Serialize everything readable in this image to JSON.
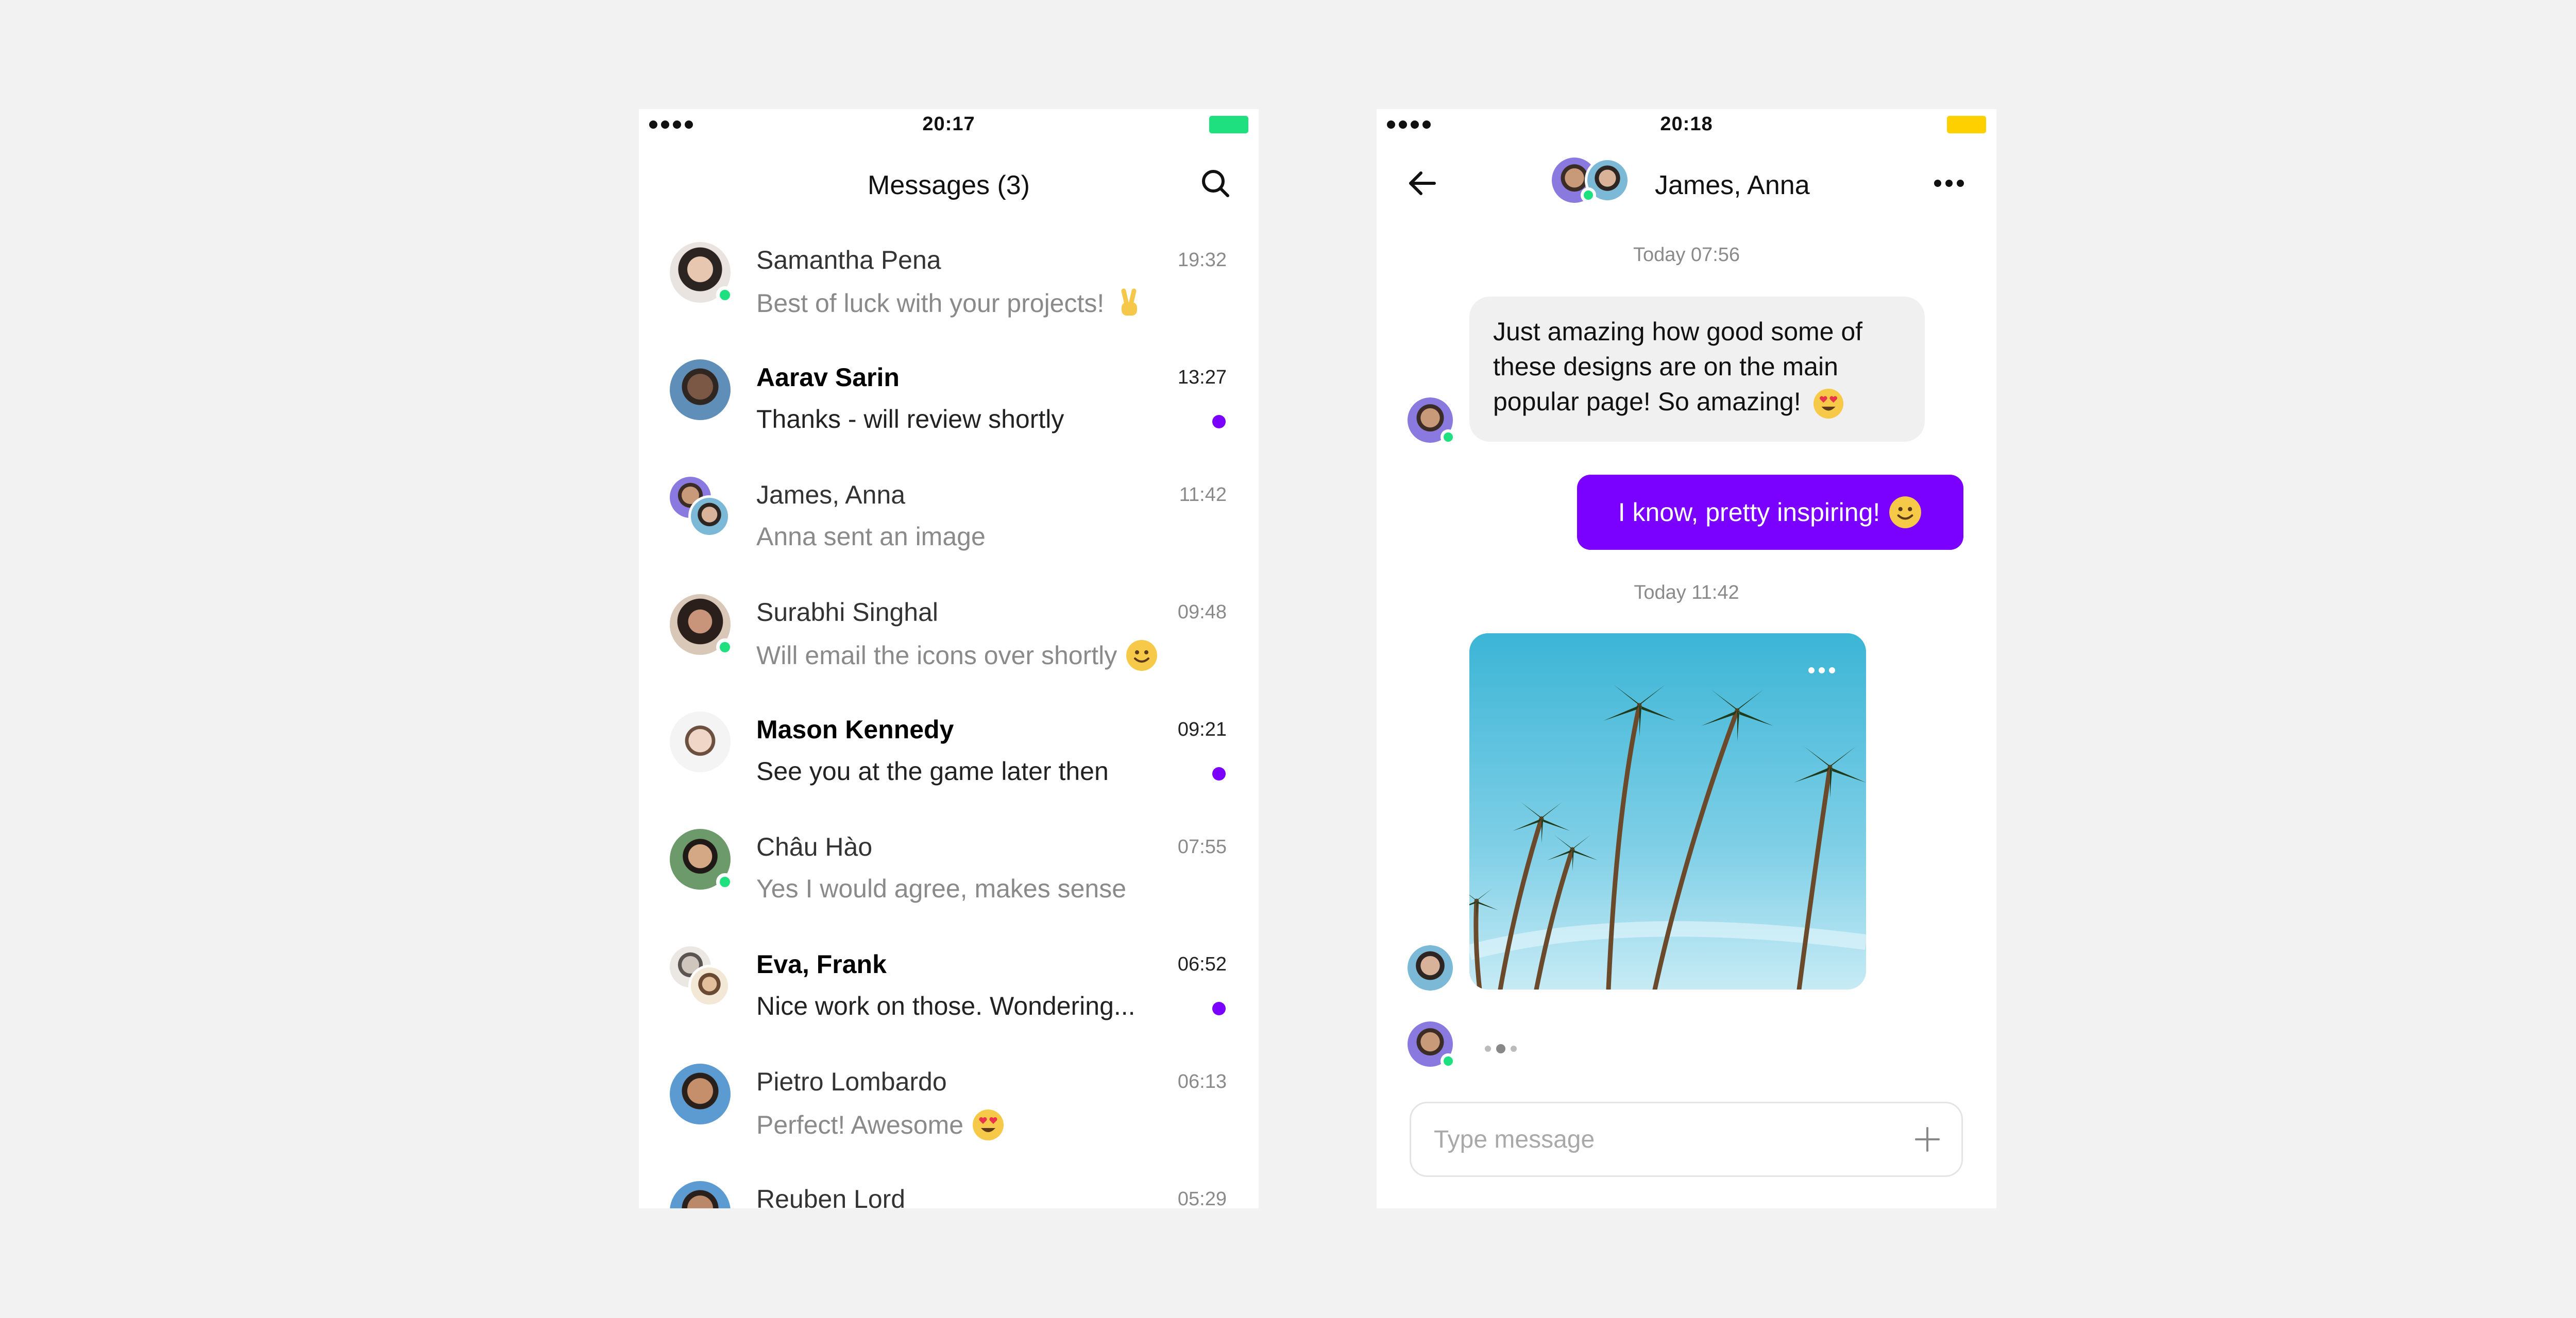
{
  "colors": {
    "accent": "#7a00ff",
    "online": "#1ee07e",
    "battery_list": "#1ee07e",
    "battery_chat": "#ffd000",
    "background": "#f2f2f2"
  },
  "list_screen": {
    "status_time": "20:17",
    "title": "Messages (3)",
    "search_icon": "search-icon",
    "conversations": [
      {
        "name": "Samantha Pena",
        "preview": "Best of luck with your projects!",
        "emoji": "victory-hand",
        "time": "19:32",
        "unread": false,
        "online": true,
        "group": false
      },
      {
        "name": "Aarav Sarin",
        "preview": "Thanks - will review shortly",
        "time": "13:27",
        "unread": true,
        "online": false,
        "group": false
      },
      {
        "name": "James, Anna",
        "preview": "Anna sent an image",
        "time": "11:42",
        "unread": false,
        "online": false,
        "group": true
      },
      {
        "name": "Surabhi Singhal",
        "preview": "Will email the icons over shortly",
        "emoji": "smiling-face",
        "time": "09:48",
        "unread": false,
        "online": true,
        "group": false
      },
      {
        "name": "Mason Kennedy",
        "preview": "See you at the game later then",
        "time": "09:21",
        "unread": true,
        "online": false,
        "group": false
      },
      {
        "name": "Châu Hào",
        "preview": "Yes I would agree, makes sense",
        "time": "07:55",
        "unread": false,
        "online": true,
        "group": false
      },
      {
        "name": "Eva, Frank",
        "preview": "Nice work on those. Wondering...",
        "time": "06:52",
        "unread": true,
        "online": false,
        "group": true
      },
      {
        "name": "Pietro Lombardo",
        "preview": "Perfect! Awesome",
        "emoji": "heart-eyes",
        "time": "06:13",
        "unread": false,
        "online": false,
        "group": false
      },
      {
        "name": "Reuben Lord",
        "preview": "",
        "time": "05:29",
        "unread": false,
        "online": false,
        "group": false
      }
    ]
  },
  "chat_screen": {
    "status_time": "20:18",
    "title": "James, Anna",
    "separator_1": "Today 07:56",
    "incoming_message": "Just amazing how good some of these designs are on the main popular page! So amazing!",
    "incoming_emoji": "heart-eyes",
    "outgoing_message": "I know, pretty inspiring!",
    "outgoing_emoji": "smiling-face",
    "separator_2": "Today 11:42",
    "image_description_icon": "palm-trees-photo",
    "input_placeholder": "Type message"
  }
}
